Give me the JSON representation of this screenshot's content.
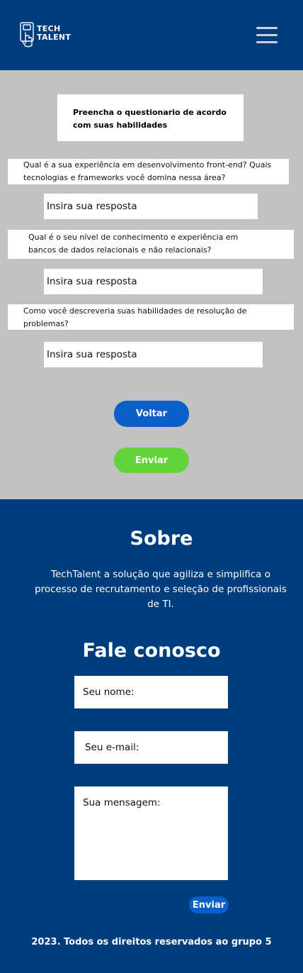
{
  "header": {
    "logo_text_line1": "TECH",
    "logo_text_line2": "TALENT",
    "menu_icon": "hamburger-menu-icon"
  },
  "form": {
    "intro": "Preencha o questionario de acordo com suas habilidades",
    "questions": [
      {
        "text": "Qual é a sua experiência em desenvolvimento front-end? Quais tecnologias e frameworks você domina nessa área?",
        "placeholder": "Insira sua resposta"
      },
      {
        "text": "Qual é o seu nível de conhecimento e experiência em bancos de dados relacionais e não relacionais?",
        "placeholder": "Insira sua resposta"
      },
      {
        "text": "Como você descreveria suas habilidades de resolução de problemas?",
        "placeholder": "Insira sua resposta"
      }
    ],
    "back_label": "Voltar",
    "submit_label": "Enviar"
  },
  "footer": {
    "about_title": "Sobre",
    "about_text": "TechTalent a solução que agiliza e simplifica o processo de recrutamento e seleção de profissionais de TI.",
    "contact_title": "Fale conosco",
    "name_placeholder": "Seu nome:",
    "email_placeholder": "Seu e-mail:",
    "message_placeholder": "Sua mensagem:",
    "send_label": "Enviar",
    "copyright": "2023. Todos os direitos reservados ao grupo 5"
  },
  "colors": {
    "brand_blue": "#003d7d",
    "button_blue": "#0b5fc9",
    "button_green": "#61d43a",
    "content_grey": "#c2c2c2"
  }
}
